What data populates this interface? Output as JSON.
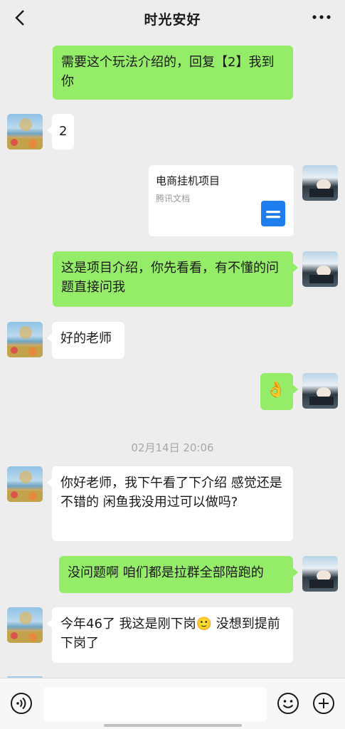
{
  "header": {
    "title": "时光安好"
  },
  "messages": {
    "m1": "需要这个玩法介绍的，回复【2】我到你",
    "m2": "2",
    "card": {
      "title": "电商挂机项目",
      "source": "腾讯文档"
    },
    "m3": "这是项目介绍，你先看看，有不懂的问题直接问我",
    "m4": "好的老师",
    "m5_emoji": "👌",
    "timestamp": "02月14日 20:06",
    "m6": "你好老师，我下午看了下介绍 感觉还是不错的  闲鱼我没用过可以做吗?",
    "m7": "没问题啊 咱们都是拉群全部陪跑的",
    "m8": "今年46了 我这是刚下岗🙂 没想到提前下岗了"
  },
  "colors": {
    "sent_bubble": "#95ec69",
    "received_bubble": "#ffffff",
    "background": "#ededed"
  },
  "icons": [
    "back-icon",
    "more-icon",
    "doc-icon",
    "voice-icon",
    "emoji-icon",
    "plus-icon"
  ]
}
